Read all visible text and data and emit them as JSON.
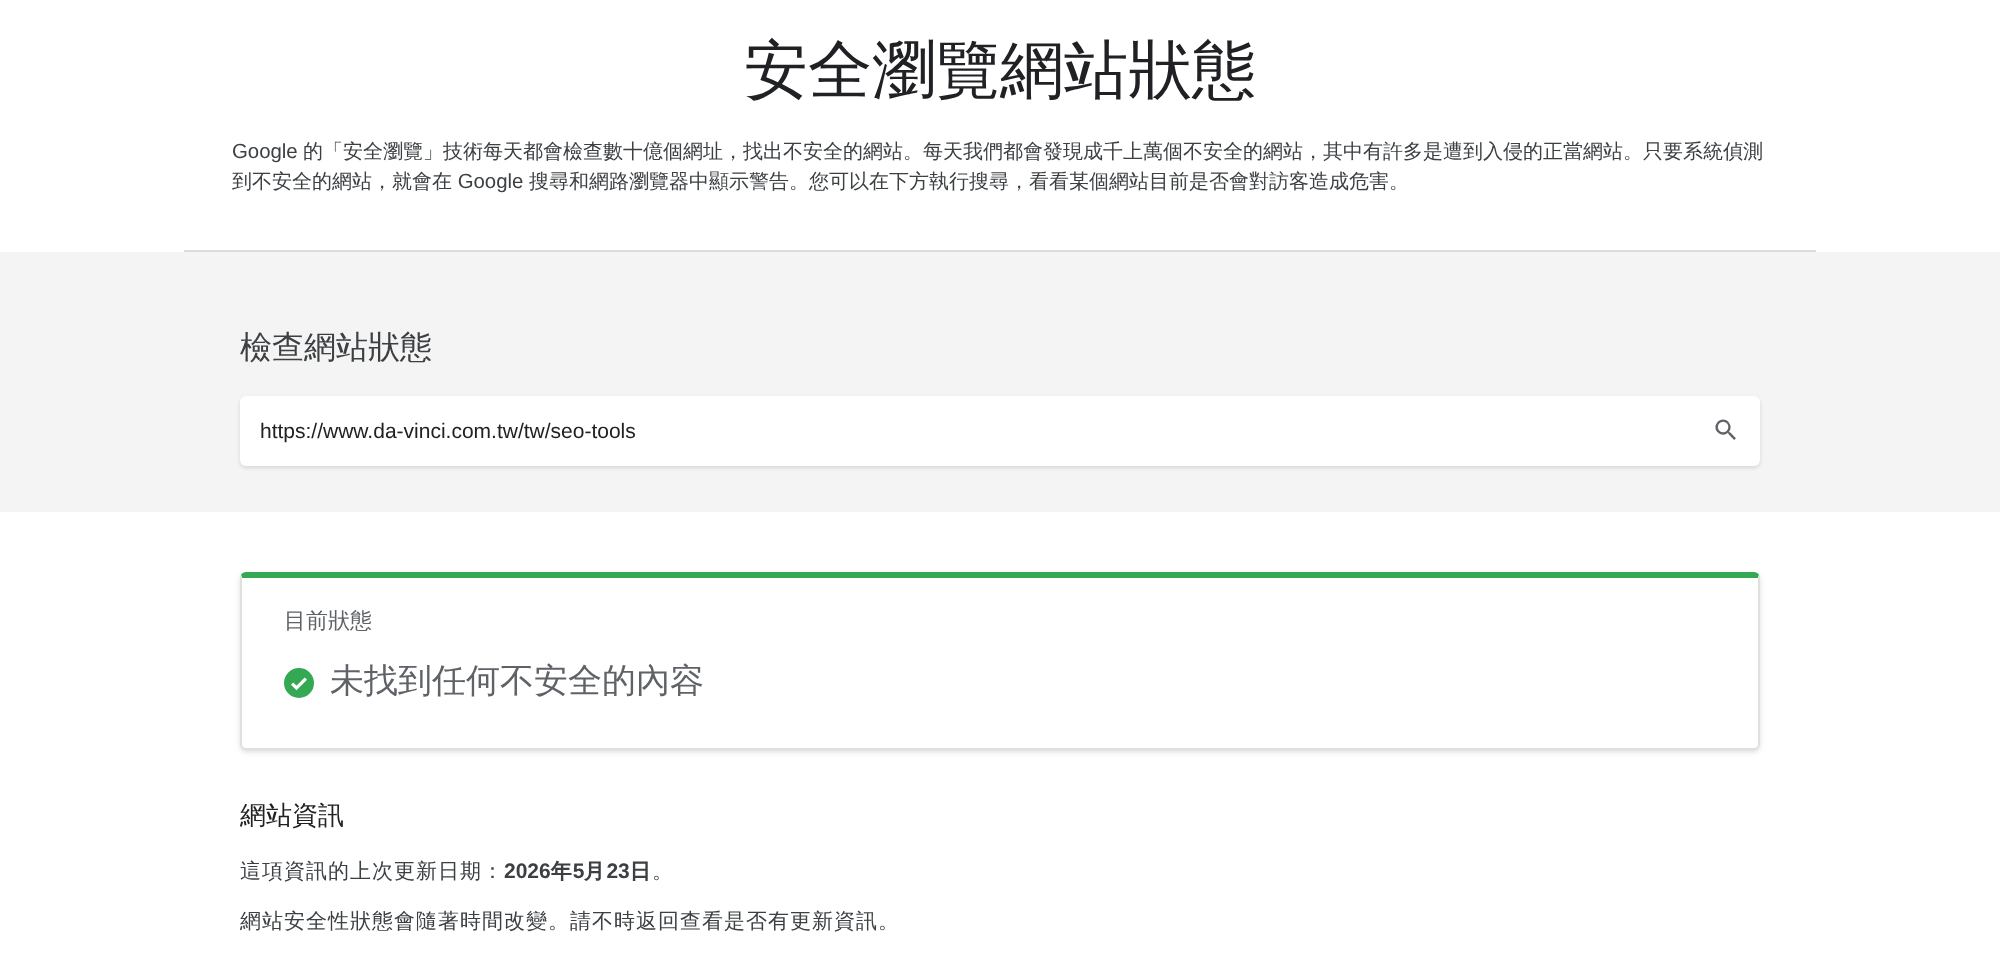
{
  "title": "安全瀏覽網站狀態",
  "intro": "Google 的「安全瀏覽」技術每天都會檢查數十億個網址，找出不安全的網站。每天我們都會發現成千上萬個不安全的網站，其中有許多是遭到入侵的正當網站。只要系統偵測到不安全的網站，就會在 Google 搜尋和網路瀏覽器中顯示警告。您可以在下方執行搜尋，看看某個網站目前是否會對訪客造成危害。",
  "check": {
    "heading": "檢查網站狀態",
    "search": {
      "value": "https://www.da-vinci.com.tw/tw/seo-tools"
    }
  },
  "status": {
    "label": "目前狀態",
    "kind": "safe",
    "result": "未找到任何不安全的內容"
  },
  "site_info": {
    "heading": "網站資訊",
    "lines": [
      "這項資訊的上次更新日期：**2026年5月23日**。",
      "網站安全性狀態會隨著時間改變。請不時返回查看是否有更新資訊。"
    ]
  }
}
